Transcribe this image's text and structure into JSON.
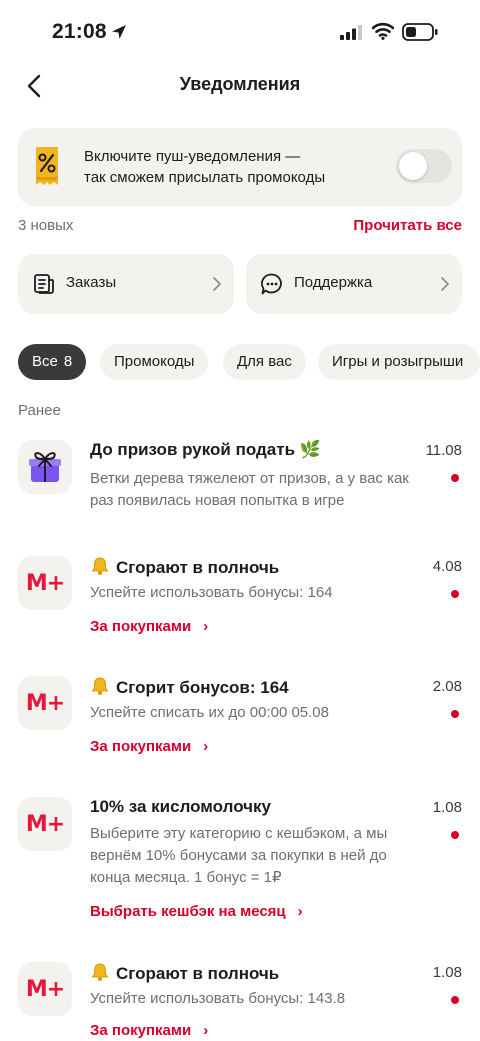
{
  "status_bar": {
    "time": "21:08"
  },
  "header": {
    "title": "Уведомления"
  },
  "push_banner": {
    "line1": "Включите пуш-уведомления —",
    "line2": "так сможем присылать промокоды",
    "toggle_on": false
  },
  "summary": {
    "new_count": "3 новых",
    "read_all": "Прочитать все"
  },
  "categories": [
    {
      "label": "Заказы",
      "icon": "receipt-icon"
    },
    {
      "label": "Поддержка",
      "icon": "chat-icon"
    }
  ],
  "filters": [
    {
      "label": "Все",
      "count": "8",
      "active": true
    },
    {
      "label": "Промокоды"
    },
    {
      "label": "Для вас"
    },
    {
      "label": "Игры и розыгрыши"
    }
  ],
  "section_label": "Ранее",
  "notifications": [
    {
      "icon": "gift-icon",
      "title": "До призов рукой подать 🌿",
      "date": "11.08",
      "body_lines": [
        "Ветки дерева тяжелеют от призов, а у вас как",
        "раз появилась новая попытка в игре"
      ],
      "unread": true
    },
    {
      "icon": "mplus-logo",
      "logo_text": "М+",
      "title": "Сгорают в полночь",
      "bell": true,
      "date": "4.08",
      "body_lines": [
        "Успейте использовать бонусы: 164"
      ],
      "link": "За покупками",
      "unread": true
    },
    {
      "icon": "mplus-logo",
      "logo_text": "М+",
      "title": "Сгорит бонусов: 164",
      "bell": true,
      "date": "2.08",
      "body_lines": [
        "Успейте списать их до 00:00 05.08"
      ],
      "link": "За покупками",
      "unread": true
    },
    {
      "icon": "mplus-logo",
      "logo_text": "М+",
      "title": "10% за кисломолочку",
      "date": "1.08",
      "body_lines": [
        "Выберите эту категорию с кешбэком, а мы",
        "вернём 10% бонусами за покупки в ней до",
        "конца месяца. 1 бонус = 1₽"
      ],
      "link": "Выбрать кешбэк на месяц",
      "unread": true
    },
    {
      "icon": "mplus-logo",
      "logo_text": "М+",
      "title": "Сгорают в полночь",
      "bell": true,
      "date": "1.08",
      "body_lines": [
        "Успейте использовать бонусы: 143.8"
      ],
      "link": "За покупками",
      "unread": true
    }
  ],
  "colors": {
    "accent": "#d7002b",
    "card_bg": "#f3f2ef",
    "chip_active": "#3a3a3c"
  }
}
